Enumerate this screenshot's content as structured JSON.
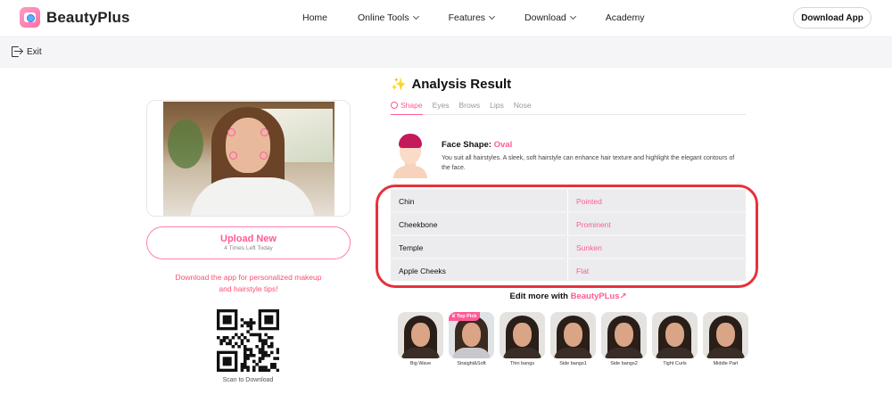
{
  "header": {
    "brand": "BeautyPlus",
    "nav": [
      {
        "label": "Home"
      },
      {
        "label": "Online Tools"
      },
      {
        "label": "Features"
      },
      {
        "label": "Download"
      },
      {
        "label": "Academy"
      }
    ],
    "download_app": "Download App"
  },
  "exit_bar": {
    "exit_label": "Exit"
  },
  "left_panel": {
    "upload_label": "Upload New",
    "upload_sub": "4 Times Left Today",
    "promo_line1": "Download the app for personalized makeup",
    "promo_line2": "and hairstyle tips!",
    "scan_text": "Scan to Download"
  },
  "result": {
    "title": "Analysis Result",
    "tabs": [
      {
        "label": "Shape",
        "active": true
      },
      {
        "label": "Eyes"
      },
      {
        "label": "Brows"
      },
      {
        "label": "Lips"
      },
      {
        "label": "Nose"
      }
    ],
    "face_shape_label": "Face Shape:",
    "face_shape_value": "Oval",
    "description": "You suit all hairstyles. A sleek, soft hairstyle can enhance hair texture and highlight the elegant contours of the face.",
    "features": [
      {
        "name": "Chin",
        "value": "Pointed"
      },
      {
        "name": "Cheekbone",
        "value": "Prominent"
      },
      {
        "name": "Temple",
        "value": "Sunken"
      },
      {
        "name": "Apple Cheeks",
        "value": "Flat"
      }
    ],
    "edit_more_prefix": "Edit more with",
    "edit_more_brand": "BeautyPLus↗",
    "top_pick": "Top Pick",
    "hairstyles": [
      {
        "label": "Big Wave"
      },
      {
        "label": "Straight&Soft"
      },
      {
        "label": "Thin bangs"
      },
      {
        "label": "Side bangs1"
      },
      {
        "label": "Side bangs2"
      },
      {
        "label": "Tight Curls"
      },
      {
        "label": "Middle Part"
      }
    ]
  },
  "colors": {
    "accent_pink": "#ff5a97",
    "highlight_red": "#e8303c",
    "promo_red": "#ff4d6d"
  }
}
